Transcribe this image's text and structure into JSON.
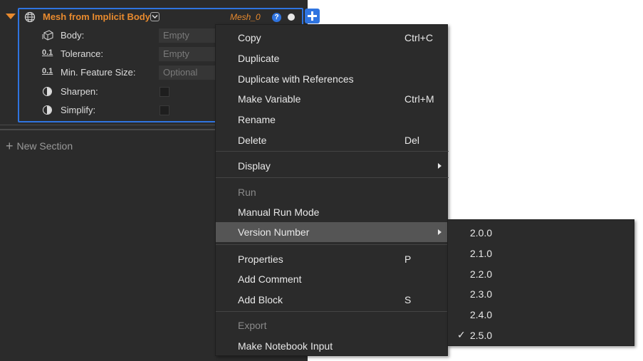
{
  "block": {
    "title": "Mesh from Implicit Body",
    "variable": "Mesh_0",
    "help": "?",
    "properties": [
      {
        "label": "Body:",
        "icon": "body-icon",
        "value": "Empty"
      },
      {
        "label": "Tolerance:",
        "icon": "number-icon",
        "value": "Empty"
      },
      {
        "label": "Min. Feature Size:",
        "icon": "number-icon",
        "value": "Optional"
      },
      {
        "label": "Sharpen:",
        "icon": "boolean-icon",
        "value": ""
      },
      {
        "label": "Simplify:",
        "icon": "boolean-icon",
        "value": ""
      }
    ],
    "number_icon_text": "0.1"
  },
  "new_section": "New Section",
  "context_menu": {
    "items": [
      {
        "label": "Copy",
        "shortcut": "Ctrl+C"
      },
      {
        "label": "Duplicate",
        "shortcut": ""
      },
      {
        "label": "Duplicate with References",
        "shortcut": ""
      },
      {
        "label": "Make Variable",
        "shortcut": "Ctrl+M"
      },
      {
        "label": "Rename",
        "shortcut": ""
      },
      {
        "label": "Delete",
        "shortcut": "Del"
      },
      {
        "label": "Display",
        "shortcut": ""
      },
      {
        "label": "Run",
        "shortcut": ""
      },
      {
        "label": "Manual Run Mode",
        "shortcut": ""
      },
      {
        "label": "Version Number",
        "shortcut": ""
      },
      {
        "label": "Properties",
        "shortcut": "P"
      },
      {
        "label": "Add Comment",
        "shortcut": ""
      },
      {
        "label": "Add Block",
        "shortcut": "S"
      },
      {
        "label": "Export",
        "shortcut": ""
      },
      {
        "label": "Make Notebook Input",
        "shortcut": ""
      }
    ]
  },
  "version_menu": {
    "items": [
      "2.0.0",
      "2.1.0",
      "2.2.0",
      "2.3.0",
      "2.4.0",
      "2.5.0"
    ],
    "selected": "2.5.0",
    "check": "✓"
  },
  "colors": {
    "accent": "#2f74e0",
    "block_title": "#e88a2e",
    "menu_bg": "#2b2b2b",
    "highlight": "#555555"
  }
}
